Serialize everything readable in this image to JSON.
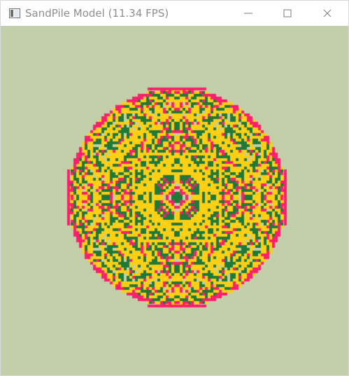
{
  "window": {
    "title": "SandPile Model (11.34 FPS)"
  },
  "titlebar_buttons": {
    "minimize": "minimize-icon",
    "maximize": "maximize-icon",
    "close": "close-icon"
  },
  "canvas": {
    "background_color": "#c3cfa9",
    "palette": [
      "#ffcf14",
      "#1f7a3a",
      "#ff1f6e",
      "#c3cfa9"
    ],
    "palette_names": [
      "yellow",
      "dark-green",
      "magenta",
      "background"
    ]
  }
}
